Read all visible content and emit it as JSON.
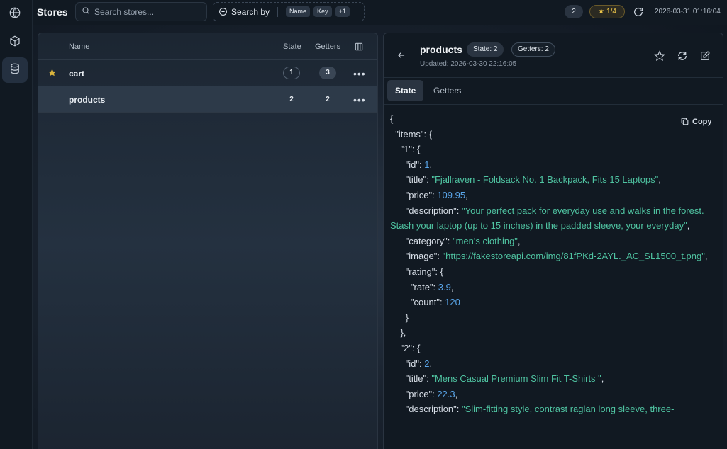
{
  "rail": {
    "items": [
      {
        "icon": "globe-icon"
      },
      {
        "icon": "cube-icon"
      },
      {
        "icon": "database-icon",
        "active": true
      }
    ]
  },
  "topbar": {
    "title": "Stores",
    "search_placeholder": "Search stores...",
    "search_by_label": "Search by",
    "search_by_chips": [
      "Name",
      "Key",
      "+1"
    ],
    "count_badge": "2",
    "favorites": "1/4",
    "timestamp": "2026-03-31 01:16:04"
  },
  "table": {
    "headers": {
      "name": "Name",
      "state": "State",
      "getters": "Getters"
    },
    "rows": [
      {
        "name": "cart",
        "state": "1",
        "getters": "3",
        "favorite": true,
        "selected": false
      },
      {
        "name": "products",
        "state": "2",
        "getters": "2",
        "favorite": false,
        "selected": true
      }
    ]
  },
  "detail": {
    "title": "products",
    "state_pill": "State: 2",
    "getters_pill": "Getters: 2",
    "updated": "Updated: 2026-03-30 22:16:05",
    "tabs": [
      "State",
      "Getters"
    ],
    "active_tab": "State",
    "copy_label": "Copy",
    "code_lines": [
      [
        {
          "t": "{"
        }
      ],
      [
        {
          "t": "  \"items\": {"
        }
      ],
      [
        {
          "t": "    \"1\": {"
        }
      ],
      [
        {
          "t": "      \"id\": "
        },
        {
          "t": "1",
          "k": "num"
        },
        {
          "t": ","
        }
      ],
      [
        {
          "t": "      \"title\": "
        },
        {
          "t": "\"Fjallraven - Foldsack No. 1 Backpack, Fits 15 Laptops\"",
          "k": "str"
        },
        {
          "t": ","
        }
      ],
      [
        {
          "t": "      \"price\": "
        },
        {
          "t": "109.95",
          "k": "num"
        },
        {
          "t": ","
        }
      ],
      [
        {
          "t": "      \"description\": "
        },
        {
          "t": "\"Your perfect pack for everyday use and walks in the forest. Stash your laptop (up to 15 inches) in the padded sleeve, your everyday\"",
          "k": "str"
        },
        {
          "t": ","
        }
      ],
      [
        {
          "t": "      \"category\": "
        },
        {
          "t": "\"men's clothing\"",
          "k": "str"
        },
        {
          "t": ","
        }
      ],
      [
        {
          "t": "      \"image\": "
        },
        {
          "t": "\"https://fakestoreapi.com/img/81fPKd-2AYL._AC_SL1500_t.png\"",
          "k": "str"
        },
        {
          "t": ","
        }
      ],
      [
        {
          "t": "      \"rating\": {"
        }
      ],
      [
        {
          "t": "        \"rate\": "
        },
        {
          "t": "3.9",
          "k": "num"
        },
        {
          "t": ","
        }
      ],
      [
        {
          "t": "        \"count\": "
        },
        {
          "t": "120",
          "k": "num"
        }
      ],
      [
        {
          "t": "      }"
        }
      ],
      [
        {
          "t": "    },"
        }
      ],
      [
        {
          "t": "    \"2\": {"
        }
      ],
      [
        {
          "t": "      \"id\": "
        },
        {
          "t": "2",
          "k": "num"
        },
        {
          "t": ","
        }
      ],
      [
        {
          "t": "      \"title\": "
        },
        {
          "t": "\"Mens Casual Premium Slim Fit T-Shirts \"",
          "k": "str"
        },
        {
          "t": ","
        }
      ],
      [
        {
          "t": "      \"price\": "
        },
        {
          "t": "22.3",
          "k": "num"
        },
        {
          "t": ","
        }
      ],
      [
        {
          "t": "      \"description\": "
        },
        {
          "t": "\"Slim-fitting style, contrast raglan long sleeve, three-",
          "k": "str"
        }
      ]
    ]
  },
  "colors": {
    "string": "#4fc3a1",
    "number": "#5aa6ea",
    "favorite": "#d9b43d"
  }
}
